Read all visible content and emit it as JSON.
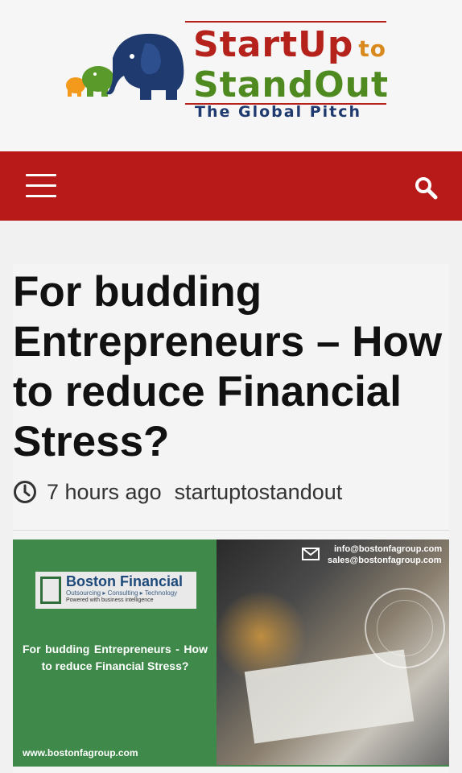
{
  "header": {
    "logo": {
      "line1": "StartUp",
      "line1_small": "to",
      "line2": "StandOut",
      "line3": "The Global Pitch"
    }
  },
  "navbar": {
    "menu_icon": "hamburger-menu-icon",
    "search_icon": "search-icon",
    "background_color": "#b81a1a"
  },
  "article": {
    "title": "For budding Entrepreneurs – How to reduce Financial Stress?",
    "time_ago": "7 hours ago",
    "author": "startuptostandout",
    "featured_image": {
      "brand_name": "Boston Financial",
      "brand_tagline": "Outsourcing ▸ Consulting ▸ Technology",
      "brand_sub": "Powered with business intelligence",
      "heading": "For budding Entrepreneurs - How to reduce Financial Stress?",
      "website": "www.bostonfagroup.com",
      "email1": "info@bostonfagroup.com",
      "email2": "sales@bostonfagroup.com"
    }
  },
  "colors": {
    "brand_red": "#b5211b",
    "brand_green": "#4e8a1f",
    "brand_navy": "#1f3a6e",
    "image_green": "#3f8a4a"
  }
}
